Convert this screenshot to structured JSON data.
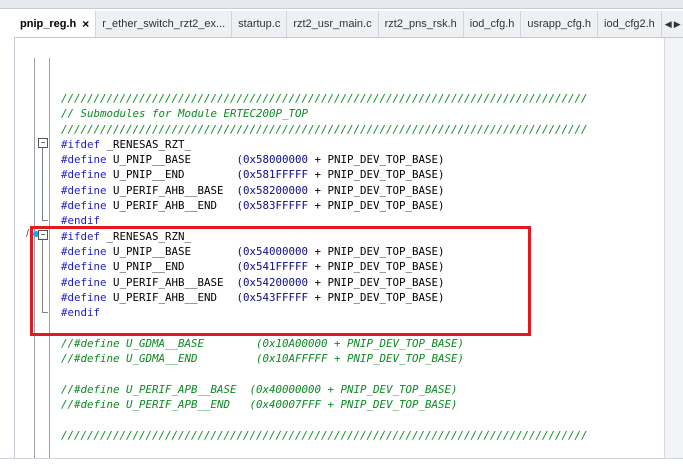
{
  "tabs": [
    {
      "label": "pnip_reg.h",
      "active": true,
      "close": "×"
    },
    {
      "label": "r_ether_switch_rzt2_ex...",
      "active": false
    },
    {
      "label": "startup.c",
      "active": false
    },
    {
      "label": "rzt2_usr_main.c",
      "active": false
    },
    {
      "label": "rzt2_pns_rsk.h",
      "active": false
    },
    {
      "label": "iod_cfg.h",
      "active": false
    },
    {
      "label": "usrapp_cfg.h",
      "active": false
    },
    {
      "label": "iod_cfg2.h",
      "active": false
    }
  ],
  "colors": {
    "highlight_box": "#e3191e",
    "comment": "#0b8a22",
    "keyword": "#1c1cd0",
    "bookmark": "#1aa5e8"
  },
  "code_lines": [
    {
      "kind": "comment",
      "text": "/////////////////////////////////////////////////////////////////////////////////"
    },
    {
      "kind": "comment",
      "text": "// Submodules for Module ERTEC200P_TOP"
    },
    {
      "kind": "comment",
      "text": "/////////////////////////////////////////////////////////////////////////////////"
    },
    {
      "kind": "pre",
      "kw": "#ifdef",
      "rest": " _RENESAS_RZT_"
    },
    {
      "kind": "define",
      "kw": "#define",
      "rest": " U_PNIP__BASE       ",
      "num": "(0x58000000",
      "tail": " + PNIP_DEV_TOP_BASE)"
    },
    {
      "kind": "define",
      "kw": "#define",
      "rest": " U_PNIP__END        ",
      "num": "(0x581FFFFF",
      "tail": " + PNIP_DEV_TOP_BASE)"
    },
    {
      "kind": "define",
      "kw": "#define",
      "rest": " U_PERIF_AHB__BASE  ",
      "num": "(0x58200000",
      "tail": " + PNIP_DEV_TOP_BASE)"
    },
    {
      "kind": "define",
      "kw": "#define",
      "rest": " U_PERIF_AHB__END   ",
      "num": "(0x583FFFFF",
      "tail": " + PNIP_DEV_TOP_BASE)"
    },
    {
      "kind": "pre",
      "kw": "#endif",
      "rest": ""
    },
    {
      "kind": "pre",
      "kw": "#ifdef",
      "rest": " _RENESAS_RZN_"
    },
    {
      "kind": "define",
      "kw": "#define",
      "rest": " U_PNIP__BASE       ",
      "num": "(0x54000000",
      "tail": " + PNIP_DEV_TOP_BASE)"
    },
    {
      "kind": "define",
      "kw": "#define",
      "rest": " U_PNIP__END        ",
      "num": "(0x541FFFFF",
      "tail": " + PNIP_DEV_TOP_BASE)"
    },
    {
      "kind": "define",
      "kw": "#define",
      "rest": " U_PERIF_AHB__BASE  ",
      "num": "(0x54200000",
      "tail": " + PNIP_DEV_TOP_BASE)"
    },
    {
      "kind": "define",
      "kw": "#define",
      "rest": " U_PERIF_AHB__END   ",
      "num": "(0x543FFFFF",
      "tail": " + PNIP_DEV_TOP_BASE)"
    },
    {
      "kind": "pre",
      "kw": "#endif",
      "rest": ""
    },
    {
      "kind": "blank",
      "text": ""
    },
    {
      "kind": "comment",
      "text": "//#define U_GDMA__BASE        (0x10A00000 + PNIP_DEV_TOP_BASE)"
    },
    {
      "kind": "comment",
      "text": "//#define U_GDMA__END         (0x10AFFFFF + PNIP_DEV_TOP_BASE)"
    },
    {
      "kind": "blank",
      "text": ""
    },
    {
      "kind": "comment",
      "text": "//#define U_PERIF_APB__BASE  (0x40000000 + PNIP_DEV_TOP_BASE)"
    },
    {
      "kind": "comment",
      "text": "//#define U_PERIF_APB__END   (0x40007FFF + PNIP_DEV_TOP_BASE)"
    },
    {
      "kind": "blank",
      "text": ""
    },
    {
      "kind": "comment",
      "text": "/////////////////////////////////////////////////////////////////////////////////"
    }
  ]
}
